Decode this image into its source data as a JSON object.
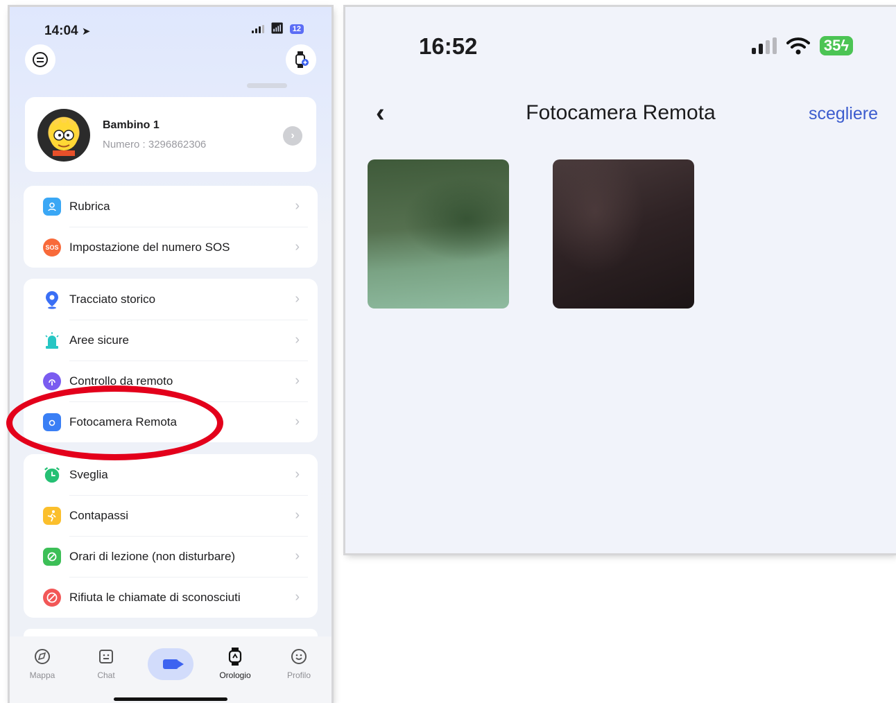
{
  "left_screen": {
    "status_bar": {
      "time": "14:04",
      "location_arrow": "➤",
      "battery": "12"
    },
    "profile": {
      "name": "Bambino 1",
      "number": "Numero : 3296862306"
    },
    "sections": [
      {
        "items": [
          {
            "label": "Rubrica",
            "icon": "contacts-icon",
            "color": "#3aa7f5"
          },
          {
            "label": "Impostazione del numero SOS",
            "icon": "sos-icon",
            "color": "#f86a3a"
          }
        ]
      },
      {
        "items": [
          {
            "label": "Tracciato storico",
            "icon": "location-pin-icon",
            "color": "#3a6ff5"
          },
          {
            "label": "Aree sicure",
            "icon": "safe-area-icon",
            "color": "#27c6c3"
          },
          {
            "label": "Controllo da remoto",
            "icon": "remote-control-icon",
            "color": "#7a5cf0"
          },
          {
            "label": "Fotocamera Remota",
            "icon": "camera-icon",
            "color": "#3a7ff5"
          }
        ]
      },
      {
        "items": [
          {
            "label": "Sveglia",
            "icon": "alarm-clock-icon",
            "color": "#25c074"
          },
          {
            "label": "Contapassi",
            "icon": "step-counter-icon",
            "color": "#fbbf2c"
          },
          {
            "label": "Orari di lezione (non disturbare)",
            "icon": "do-not-disturb-icon",
            "color": "#3cbf57"
          },
          {
            "label": "Rifiuta le chiamate di sconosciuti",
            "icon": "block-calls-icon",
            "color": "#f25757"
          }
        ]
      }
    ],
    "tabs": [
      {
        "label": "Mappa",
        "icon": "compass-icon"
      },
      {
        "label": "Chat",
        "icon": "chat-icon"
      },
      {
        "label": "",
        "icon": "video-call-icon"
      },
      {
        "label": "Orologio",
        "icon": "watch-icon"
      },
      {
        "label": "Profilo",
        "icon": "smiley-icon"
      }
    ],
    "accent_color": "#3d63f0",
    "highlight_color": "#e3001b"
  },
  "right_screen": {
    "status_bar": {
      "time": "16:52",
      "battery": "35"
    },
    "title": "Fotocamera Remota",
    "action": "scegliere",
    "action_color": "#3c5cce",
    "photos": [
      {
        "icon": "remote-photo-thumbnail"
      },
      {
        "icon": "remote-photo-thumbnail"
      }
    ]
  }
}
